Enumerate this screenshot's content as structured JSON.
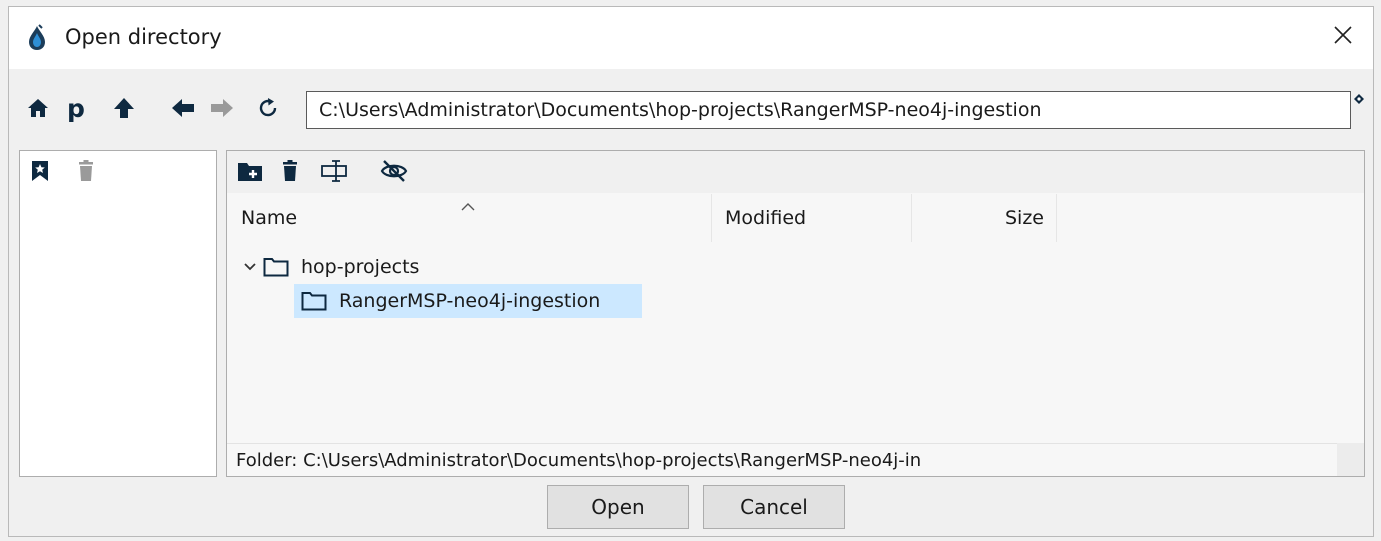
{
  "window": {
    "title": "Open directory",
    "app_icon": "hop-droplet-icon",
    "close_glyph": "✕"
  },
  "toolbar": {
    "home_icon": "home-icon",
    "project_label": "p",
    "parent_icon": "arrow-up-icon",
    "back_icon": "arrow-left-icon",
    "forward_icon": "arrow-right-icon",
    "refresh_icon": "refresh-icon",
    "path_value": "C:\\Users\\Administrator\\Documents\\hop-projects\\RangerMSP-neo4j-ingestion"
  },
  "bookmarks_toolbar": {
    "add_icon": "bookmark-icon",
    "delete_icon": "trash-icon"
  },
  "files_toolbar": {
    "new_folder_icon": "new-folder-icon",
    "delete_icon": "trash-icon",
    "rename_icon": "rename-icon",
    "hidden_icon": "eye-slash-icon"
  },
  "columns": [
    "Name",
    "Modified",
    "Size"
  ],
  "tree": [
    {
      "label": "hop-projects",
      "expanded": true,
      "depth": 0,
      "selected": false
    },
    {
      "label": "RangerMSP-neo4j-ingestion",
      "expanded": false,
      "depth": 1,
      "selected": true
    }
  ],
  "status": {
    "folder_text": "Folder: C:\\Users\\Administrator\\Documents\\hop-projects\\RangerMSP-neo4j-in"
  },
  "buttons": {
    "open": "Open",
    "cancel": "Cancel"
  },
  "colors": {
    "selection": "#cce8ff",
    "icon": "#0e2940",
    "accent": "#1f8ad2"
  }
}
